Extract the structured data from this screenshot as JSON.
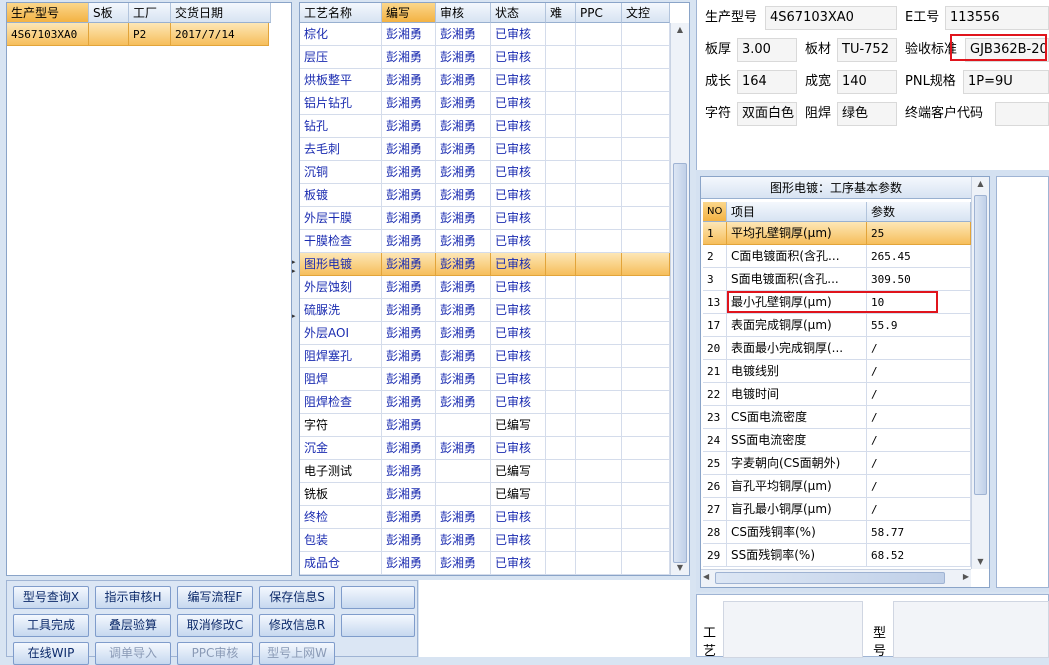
{
  "left_table": {
    "headers": [
      "生产型号",
      "S板",
      "工厂",
      "交货日期"
    ],
    "rows": [
      [
        "4S67103XA0",
        "",
        "P2",
        "2017/7/14"
      ]
    ]
  },
  "process_table": {
    "headers": [
      "工艺名称",
      "编写",
      "审核",
      "状态",
      "难",
      "PPC",
      "文控"
    ],
    "rows": [
      [
        "棕化",
        "彭湘勇",
        "彭湘勇",
        "已审核"
      ],
      [
        "层压",
        "彭湘勇",
        "彭湘勇",
        "已审核"
      ],
      [
        "烘板整平",
        "彭湘勇",
        "彭湘勇",
        "已审核"
      ],
      [
        "铝片钻孔",
        "彭湘勇",
        "彭湘勇",
        "已审核"
      ],
      [
        "钻孔",
        "彭湘勇",
        "彭湘勇",
        "已审核"
      ],
      [
        "去毛刺",
        "彭湘勇",
        "彭湘勇",
        "已审核"
      ],
      [
        "沉铜",
        "彭湘勇",
        "彭湘勇",
        "已审核"
      ],
      [
        "板镀",
        "彭湘勇",
        "彭湘勇",
        "已审核"
      ],
      [
        "外层干膜",
        "彭湘勇",
        "彭湘勇",
        "已审核"
      ],
      [
        "干膜检查",
        "彭湘勇",
        "彭湘勇",
        "已审核"
      ],
      [
        "图形电镀",
        "彭湘勇",
        "彭湘勇",
        "已审核"
      ],
      [
        "外层蚀刻",
        "彭湘勇",
        "彭湘勇",
        "已审核"
      ],
      [
        "硫脲洗",
        "彭湘勇",
        "彭湘勇",
        "已审核"
      ],
      [
        "外层AOI",
        "彭湘勇",
        "彭湘勇",
        "已审核"
      ],
      [
        "阻焊塞孔",
        "彭湘勇",
        "彭湘勇",
        "已审核"
      ],
      [
        "阻焊",
        "彭湘勇",
        "彭湘勇",
        "已审核"
      ],
      [
        "阻焊检查",
        "彭湘勇",
        "彭湘勇",
        "已审核"
      ],
      [
        "字符",
        "彭湘勇",
        "",
        "已编写"
      ],
      [
        "沉金",
        "彭湘勇",
        "彭湘勇",
        "已审核"
      ],
      [
        "电子测试",
        "彭湘勇",
        "",
        "已编写"
      ],
      [
        "铣板",
        "彭湘勇",
        "",
        "已编写"
      ],
      [
        "终检",
        "彭湘勇",
        "彭湘勇",
        "已审核"
      ],
      [
        "包装",
        "彭湘勇",
        "彭湘勇",
        "已审核"
      ],
      [
        "成品仓",
        "彭湘勇",
        "彭湘勇",
        "已审核"
      ]
    ],
    "selected_index": 10
  },
  "buttons": {
    "row1": [
      "型号查询X",
      "指示审核H",
      "编写流程F",
      "保存信息S",
      ""
    ],
    "row2": [
      "工具完成",
      "叠层验算",
      "取消修改C",
      "修改信息R",
      ""
    ],
    "row3": [
      "在线WIP",
      "调单导入",
      "PPC审核",
      "型号上网W"
    ]
  },
  "info": {
    "model_label": "生产型号",
    "model_value": "4S67103XA0",
    "eno_label": "E工号",
    "eno_value": "113556",
    "thickness_label": "板厚",
    "thickness_value": "3.00",
    "material_label": "板材",
    "material_value": "TU-752",
    "standard_label": "验收标准",
    "standard_value": "GJB362B-20",
    "length_label": "成长",
    "length_value": "164",
    "width_label": "成宽",
    "width_value": "140",
    "pnl_label": "PNL规格",
    "pnl_value": "1P=9U",
    "char_label": "字符",
    "char_value": "双面白色",
    "mask_label": "阻焊",
    "mask_value": "绿色",
    "customer_label": "终端客户代码",
    "customer_value": ""
  },
  "params": {
    "title": "图形电镀：工序基本参数",
    "headers": [
      "NO",
      "项目",
      "参数"
    ],
    "rows": [
      [
        "1",
        "平均孔壁铜厚(μm)",
        "25"
      ],
      [
        "2",
        "C面电镀面积(含孔...",
        "265.45"
      ],
      [
        "3",
        "S面电镀面积(含孔...",
        "309.50"
      ],
      [
        "13",
        "最小孔壁铜厚(μm)",
        "10"
      ],
      [
        "17",
        "表面完成铜厚(μm)",
        "55.9"
      ],
      [
        "20",
        "表面最小完成铜厚(...",
        "/"
      ],
      [
        "21",
        "电镀线别",
        "/"
      ],
      [
        "22",
        "电镀时间",
        "/"
      ],
      [
        "23",
        "CS面电流密度",
        "/"
      ],
      [
        "24",
        "SS面电流密度",
        "/"
      ],
      [
        "25",
        "字麦朝向(CS面朝外)",
        "/"
      ],
      [
        "26",
        "盲孔平均铜厚(μm)",
        "/"
      ],
      [
        "27",
        "盲孔最小铜厚(μm)",
        "/"
      ],
      [
        "28",
        "CS面残铜率(%)",
        "58.77"
      ],
      [
        "29",
        "SS面残铜率(%)",
        "68.52"
      ]
    ]
  },
  "bottom_labels": {
    "a": "工艺",
    "b": "型号"
  },
  "colors": {
    "accent_orange": "#f3b243",
    "highlight_red": "#e0141c",
    "text_blue": "#1a2bb0"
  }
}
